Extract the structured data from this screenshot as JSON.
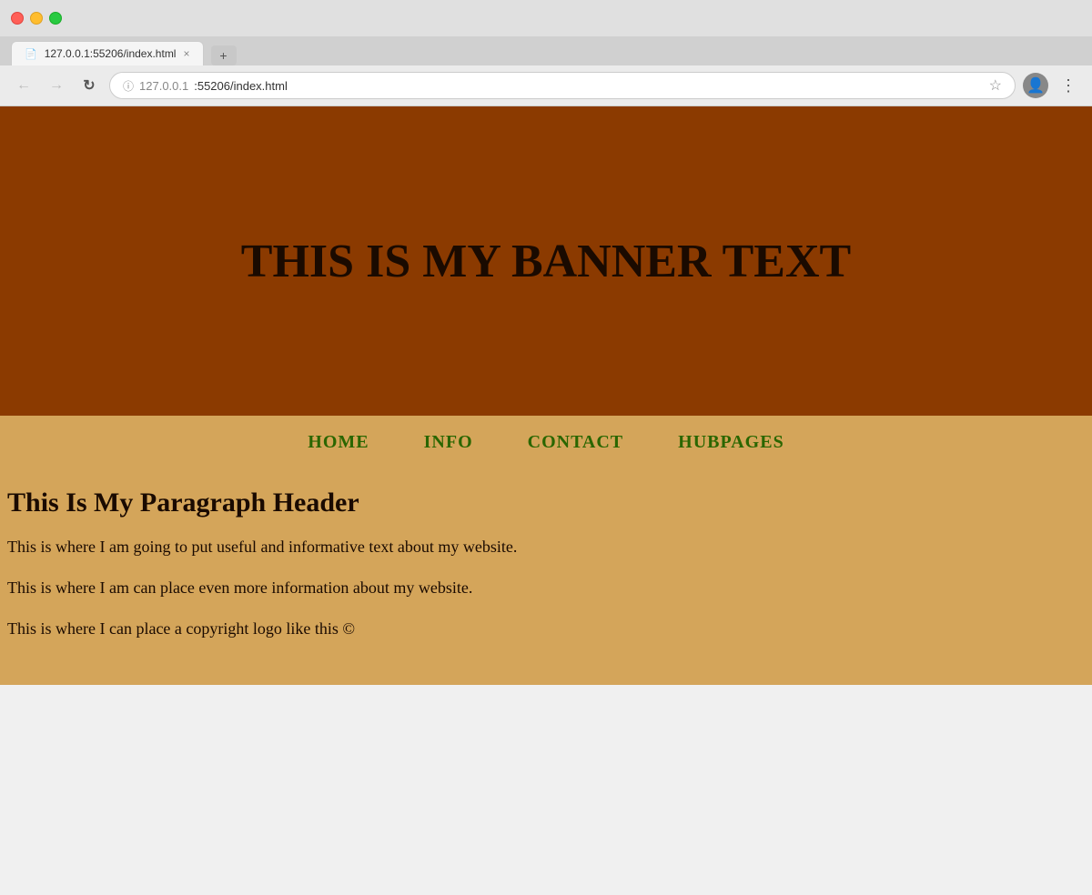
{
  "browser": {
    "url_display": "127.0.0.1:55206/index.html",
    "url_protocol": "127.0.0.1",
    "url_path": ":55206/index.html",
    "tab_title": "127.0.0.1:55206/index.html",
    "tab_icon": "📄",
    "close_label": "×",
    "new_tab_label": "+"
  },
  "nav": {
    "back_label": "←",
    "forward_label": "→",
    "reload_label": "↻",
    "star_label": "☆",
    "menu_label": "⋮"
  },
  "banner": {
    "text": "THIS IS MY BANNER TEXT"
  },
  "navbar": {
    "items": [
      {
        "label": "HOME"
      },
      {
        "label": "INFO"
      },
      {
        "label": "CONTACT"
      },
      {
        "label": "HUBPAGES"
      }
    ]
  },
  "content": {
    "header": "This Is My Paragraph Header",
    "paragraph1": "This is where I am going to put useful and informative text about my website.",
    "paragraph2": "This is where I am can place even more information about my website.",
    "paragraph3": "This is where I can place a copyright logo like this ©"
  },
  "colors": {
    "banner_bg": "#8B3A00",
    "nav_bg": "#D4A55A",
    "content_bg": "#D4A55A",
    "nav_link_color": "#2a6600",
    "text_color": "#1a0a00"
  }
}
